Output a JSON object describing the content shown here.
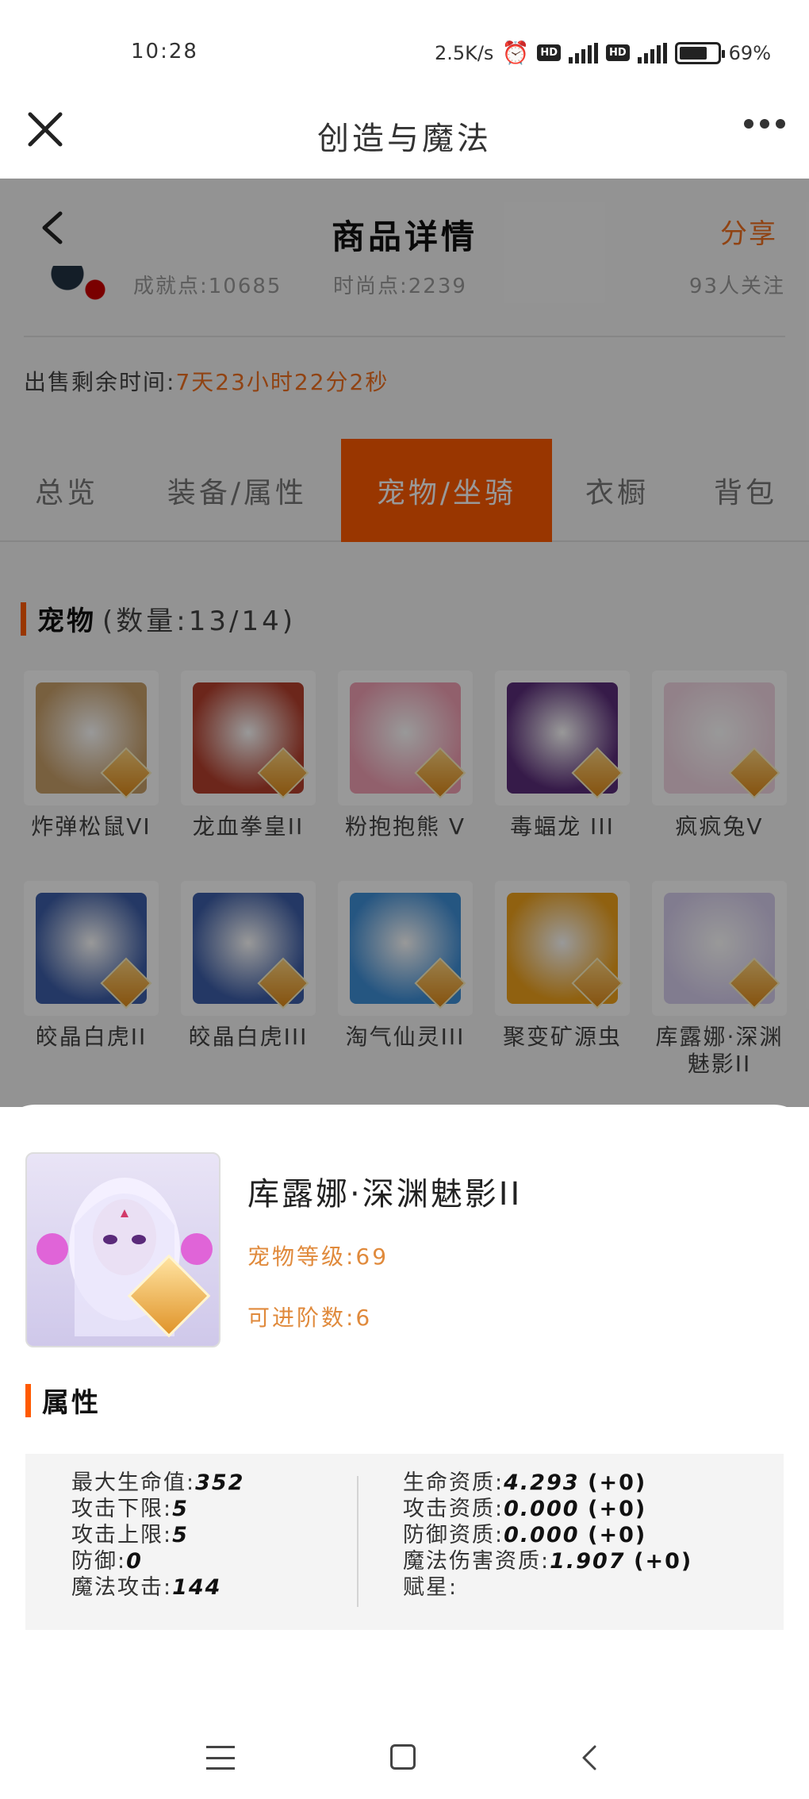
{
  "status_bar": {
    "time": "10:28",
    "net_speed": "2.5K/s",
    "battery": "69%"
  },
  "title_bar": {
    "title": "创造与魔法"
  },
  "header": {
    "title": "商品详情",
    "share": "分享"
  },
  "seller": {
    "achievement": "成就点:10685",
    "fashion": "时尚点:2239",
    "follow": "93人关注"
  },
  "remaining": {
    "label": "出售剩余时间:",
    "value": "7天23小时22分2秒"
  },
  "tabs": [
    {
      "label": "总览",
      "active": false
    },
    {
      "label": "装备/属性",
      "active": false
    },
    {
      "label": "宠物/坐骑",
      "active": true
    },
    {
      "label": "衣橱",
      "active": false
    },
    {
      "label": "背包",
      "active": false
    }
  ],
  "pets_section": {
    "title": "宠物",
    "count": "(数量:13/14)"
  },
  "pets": [
    {
      "name": "炸弹松鼠VI",
      "color": "#c9a06a"
    },
    {
      "name": "龙血拳皇II",
      "color": "#b5402e"
    },
    {
      "name": "粉抱抱熊 V",
      "color": "#f2a1b5"
    },
    {
      "name": "毒蝠龙 III",
      "color": "#5b2d7a"
    },
    {
      "name": "疯疯兔V",
      "color": "#f3d7e4"
    },
    {
      "name": "皎晶白虎II",
      "color": "#3d5ea8"
    },
    {
      "name": "皎晶白虎III",
      "color": "#3d5ea8"
    },
    {
      "name": "淘气仙灵III",
      "color": "#3f8fd8"
    },
    {
      "name": "聚变矿源虫",
      "color": "#f0a21c"
    },
    {
      "name": "库露娜·深渊魅影II",
      "color": "#d8cfef"
    }
  ],
  "detail": {
    "name": "库露娜·深渊魅影II",
    "level": "宠物等级:69",
    "advance": "可进阶数:6",
    "attr_title": "属性",
    "left": [
      {
        "label": "最大生命值:",
        "value": "352"
      },
      {
        "label": "攻击下限:",
        "value": "5"
      },
      {
        "label": "攻击上限:",
        "value": "5"
      },
      {
        "label": "防御:",
        "value": "0"
      },
      {
        "label": "魔法攻击:",
        "value": "144"
      }
    ],
    "right": [
      {
        "label": "生命资质:",
        "value": "4.293",
        "delta": "(+0)"
      },
      {
        "label": "攻击资质:",
        "value": "0.000",
        "delta": "(+0)"
      },
      {
        "label": "防御资质:",
        "value": "0.000",
        "delta": "(+0)"
      },
      {
        "label": "魔法伤害资质:",
        "value": "1.907",
        "delta": "(+0)"
      },
      {
        "label": "赋星:",
        "value": "",
        "delta": ""
      }
    ]
  }
}
